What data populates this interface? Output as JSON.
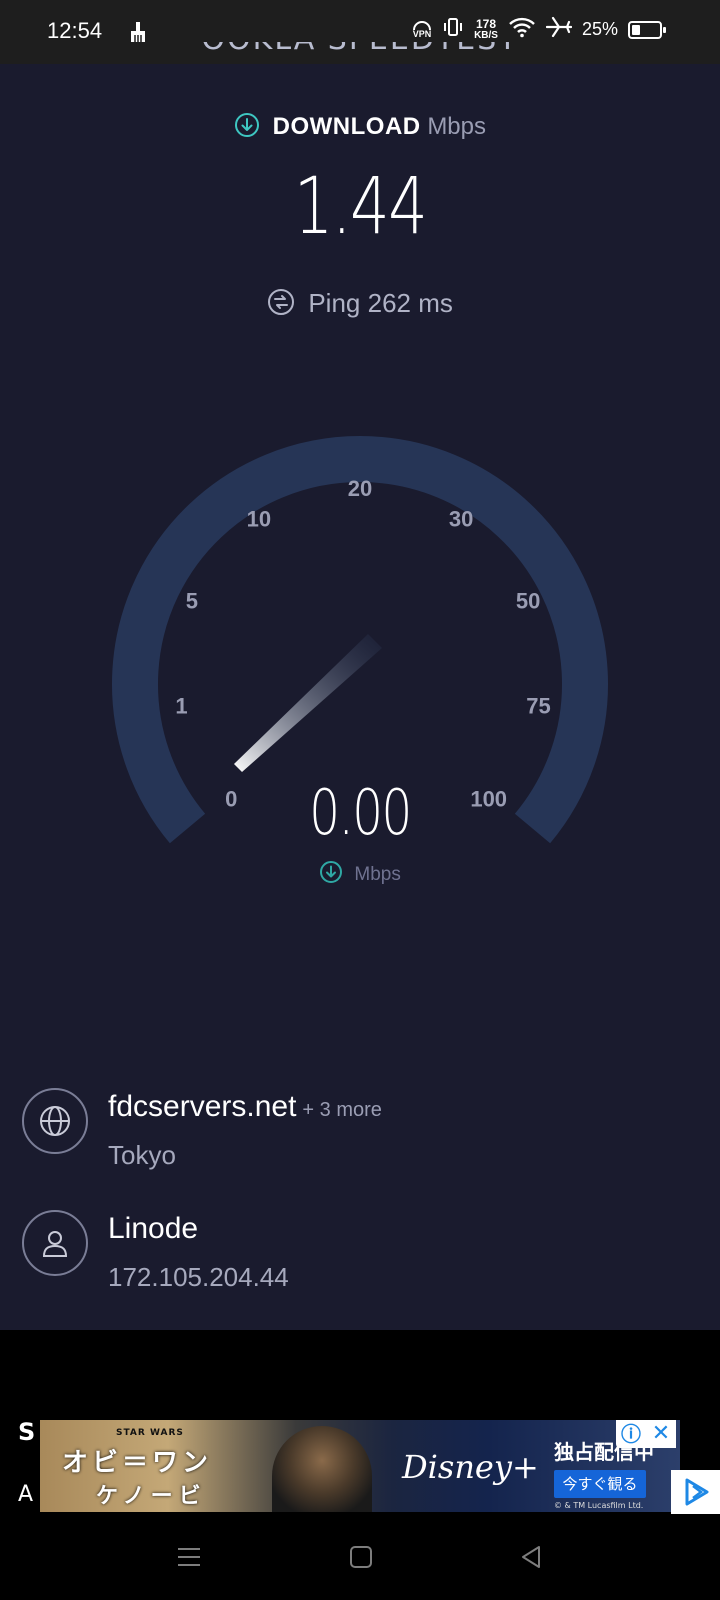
{
  "status_bar": {
    "time": "12:54",
    "vpn_label": "VPN",
    "net_speed_value": "178",
    "net_speed_unit": "KB/S",
    "battery": "25%",
    "icons": [
      "broom-icon",
      "vpn-icon",
      "vibrate-icon",
      "wifi-icon",
      "airplane-icon",
      "battery-icon"
    ]
  },
  "header": {
    "partial_title": "OOKLA SPEEDTEST"
  },
  "download": {
    "label": "DOWNLOAD",
    "unit": "Mbps",
    "value": "1.44"
  },
  "ping": {
    "text": "Ping 262 ms"
  },
  "gauge": {
    "ticks": [
      "0",
      "1",
      "5",
      "10",
      "20",
      "30",
      "50",
      "75",
      "100"
    ],
    "needle_value": 0,
    "current_value": "0.00",
    "unit": "Mbps"
  },
  "server": {
    "host": "fdcservers.net",
    "more": "+ 3 more",
    "location": "Tokyo"
  },
  "provider": {
    "name": "Linode",
    "ip": "172.105.204.44"
  },
  "ad": {
    "star_wars": "STAR WARS",
    "title_line1": "オビ＝ワン",
    "title_line2": "ケノービ",
    "brand": "Disney+",
    "exclusive": "独占配信中",
    "cta": "今すぐ観る",
    "copyright": "© & TM Lucasfilm Ltd."
  },
  "peek": {
    "line1": "S",
    "line2": "A"
  },
  "colors": {
    "background": "#1a1b2e",
    "gauge_track": "#263556",
    "accent_teal": "#3ec7c2"
  }
}
